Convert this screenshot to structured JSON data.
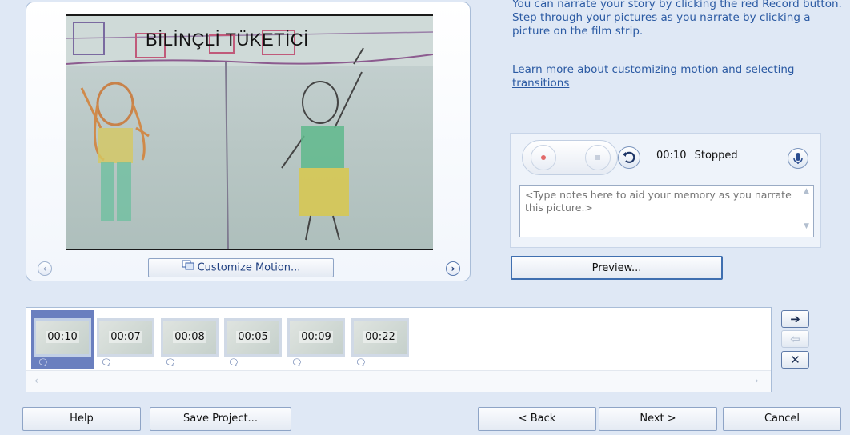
{
  "preview": {
    "title_text": "BİLİNÇLİ TÜKETİCİ",
    "customize_button": "Customize Motion...",
    "prev_icon": "chevron-left-icon",
    "next_icon": "chevron-right-icon"
  },
  "instructions": {
    "text": "You can narrate your story by clicking the red Record button. Step through your pictures as you narrate by clicking a picture on the film strip.",
    "link": "Learn more about customizing motion and selecting transitions"
  },
  "recorder": {
    "time": "00:10",
    "status": "Stopped",
    "notes_placeholder": "<Type notes here to aid your memory as you narrate this picture.>"
  },
  "preview_button": "Preview...",
  "filmstrip": {
    "thumbs": [
      {
        "duration": "00:10"
      },
      {
        "duration": "00:07"
      },
      {
        "duration": "00:08"
      },
      {
        "duration": "00:05"
      },
      {
        "duration": "00:09"
      },
      {
        "duration": "00:22"
      }
    ],
    "selected_index": 0
  },
  "side_buttons": {
    "move_right": "➔",
    "move_left": "⇦",
    "remove": "✕"
  },
  "footer": {
    "help": "Help",
    "save": "Save Project...",
    "back": "< Back",
    "next": "Next >",
    "cancel": "Cancel"
  },
  "colors": {
    "window_bg": "#dfe8f5",
    "link_blue": "#2b5aa3",
    "selection": "#6a7fbf",
    "record_red": "#e26a6a"
  }
}
